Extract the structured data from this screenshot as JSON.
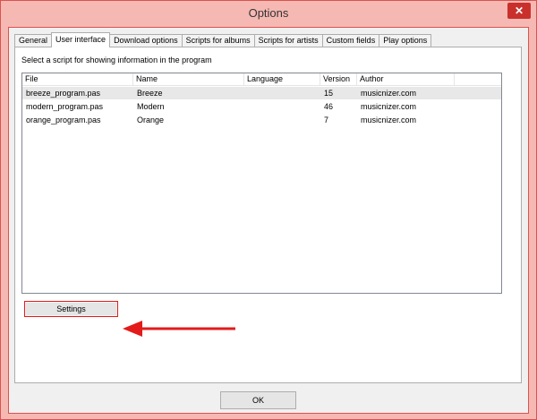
{
  "window": {
    "title": "Options",
    "close_glyph": "✕"
  },
  "tabs": [
    {
      "label": "General"
    },
    {
      "label": "User interface"
    },
    {
      "label": "Download options"
    },
    {
      "label": "Scripts for albums"
    },
    {
      "label": "Scripts for artists"
    },
    {
      "label": "Custom fields"
    },
    {
      "label": "Play options"
    }
  ],
  "panel": {
    "prompt": "Select a script for showing information in the program",
    "columns": [
      "File",
      "Name",
      "Language",
      "Version",
      "Author"
    ],
    "rows": [
      {
        "file": "breeze_program.pas",
        "name": "Breeze",
        "language": "",
        "version": "15",
        "author": "musicnizer.com"
      },
      {
        "file": "modern_program.pas",
        "name": "Modern",
        "language": "",
        "version": "46",
        "author": "musicnizer.com"
      },
      {
        "file": "orange_program.pas",
        "name": "Orange",
        "language": "",
        "version": "7",
        "author": "musicnizer.com"
      }
    ],
    "settings_label": "Settings"
  },
  "footer": {
    "ok_label": "OK"
  },
  "colors": {
    "titlebar": "#f6b8b3",
    "accent": "#e31b1b",
    "selected_row": "#e8e8e8"
  },
  "annotation": {
    "icon": "red-arrow-icon"
  }
}
